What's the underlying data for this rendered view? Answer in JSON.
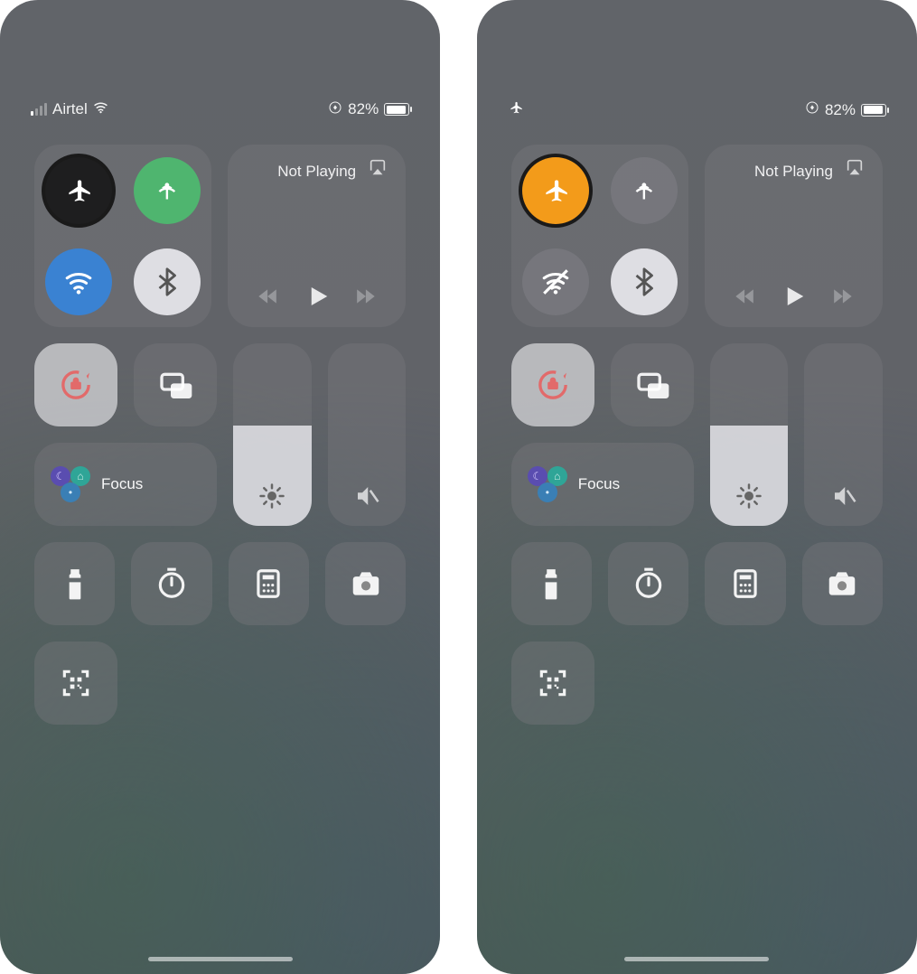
{
  "screens": [
    {
      "id": "left",
      "status": {
        "carrier": "Airtel",
        "signal_bars_active": 1,
        "wifi_visible": true,
        "airplane_indicator_visible": false,
        "rotation_lock_indicator": true,
        "battery_percent": "82%"
      },
      "connectivity": {
        "airplane": {
          "active": false,
          "highlighted": true,
          "bg": "black"
        },
        "cellular": {
          "active": true,
          "bg": "green"
        },
        "wifi": {
          "active": true,
          "bg": "blue"
        },
        "bluetooth": {
          "active": true,
          "bg": "white"
        }
      },
      "media": {
        "title": "Not Playing"
      },
      "focus": {
        "label": "Focus"
      },
      "brightness_percent": 55,
      "volume_percent": 0
    },
    {
      "id": "right",
      "status": {
        "carrier": "",
        "signal_bars_active": 0,
        "wifi_visible": false,
        "airplane_indicator_visible": true,
        "rotation_lock_indicator": true,
        "battery_percent": "82%"
      },
      "connectivity": {
        "airplane": {
          "active": true,
          "highlighted": true,
          "bg": "orange"
        },
        "cellular": {
          "active": false,
          "bg": "dim"
        },
        "wifi": {
          "active": false,
          "bg": "dim"
        },
        "bluetooth": {
          "active": true,
          "bg": "white"
        }
      },
      "media": {
        "title": "Not Playing"
      },
      "focus": {
        "label": "Focus"
      },
      "brightness_percent": 55,
      "volume_percent": 0
    }
  ],
  "icons": {
    "airplane": "airplane-icon",
    "cellular": "antenna-icon",
    "wifi": "wifi-icon",
    "wifi_off": "wifi-slash-icon",
    "bluetooth": "bluetooth-icon",
    "airplay": "airplay-icon",
    "prev": "backward-icon",
    "play": "play-icon",
    "next": "forward-icon",
    "rotation_lock": "rotation-lock-icon",
    "screen_mirror": "screen-mirror-icon",
    "brightness": "brightness-icon",
    "volume_mute": "volume-mute-icon",
    "flashlight": "flashlight-icon",
    "timer": "timer-icon",
    "calculator": "calculator-icon",
    "camera": "camera-icon",
    "qr": "qr-scan-icon"
  }
}
